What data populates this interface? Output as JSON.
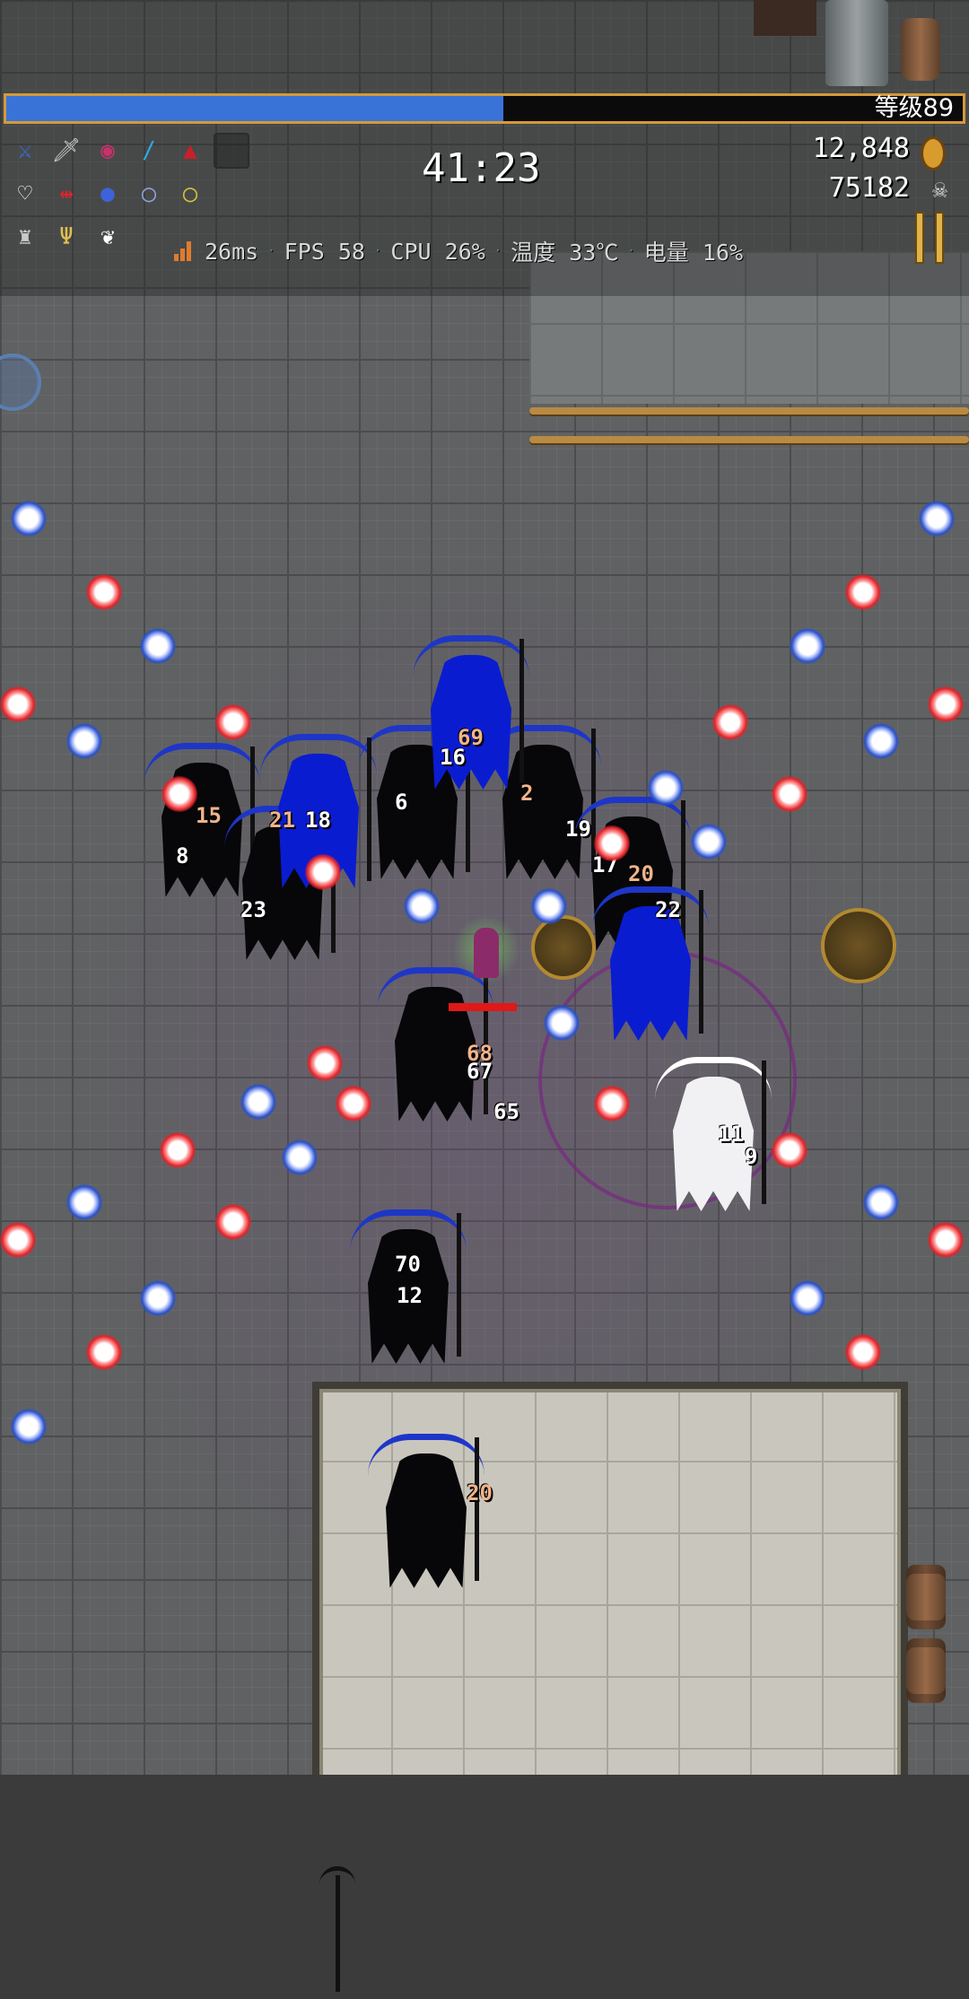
{
  "hud": {
    "level_label": "等级89",
    "xp_progress": 0.52,
    "timer": "41:23",
    "gold": "12,848",
    "kills": "75182",
    "perf": {
      "ping": "26ms",
      "fps": "FPS 58",
      "cpu": "CPU 26%",
      "temp": "温度 33℃",
      "battery": "电量 16%"
    }
  },
  "weapons": [
    {
      "name": "whip-icon",
      "color": "#3c6fd6",
      "glyph": "⚔"
    },
    {
      "name": "knife-icon",
      "color": "#c9c9c9",
      "glyph": "🗡"
    },
    {
      "name": "rose-icon",
      "color": "#c8326a",
      "glyph": "◉"
    },
    {
      "name": "wand-icon",
      "color": "#2ea7e8",
      "glyph": "∕"
    },
    {
      "name": "cloak-icon",
      "color": "#c8202a",
      "glyph": "▲"
    },
    {
      "name": "empty-slot",
      "color": "",
      "glyph": ""
    }
  ],
  "passives": [
    {
      "name": "heart-icon",
      "color": "#ffffff",
      "glyph": "♡"
    },
    {
      "name": "arrows-icon",
      "color": "#e0242a",
      "glyph": "⇹"
    },
    {
      "name": "orb-icon",
      "color": "#3d63d9",
      "glyph": "●"
    },
    {
      "name": "ring-blue-icon",
      "color": "#8ea0d8",
      "glyph": "◯"
    },
    {
      "name": "ring-gold-icon",
      "color": "#d2c23a",
      "glyph": "◯"
    }
  ],
  "extras": [
    {
      "name": "armor-icon",
      "color": "#c9c9c9",
      "glyph": "♜"
    },
    {
      "name": "candelabra-icon",
      "color": "#e0c050",
      "glyph": "Ψ"
    },
    {
      "name": "wings-icon",
      "color": "#ffffff",
      "glyph": "❦"
    }
  ],
  "damage_numbers": [
    "15",
    "8",
    "18",
    "21",
    "23",
    "6",
    "2",
    "19",
    "17",
    "20",
    "16",
    "22",
    "68",
    "67",
    "65",
    "69",
    "70",
    "12",
    "20",
    "11",
    "9"
  ]
}
